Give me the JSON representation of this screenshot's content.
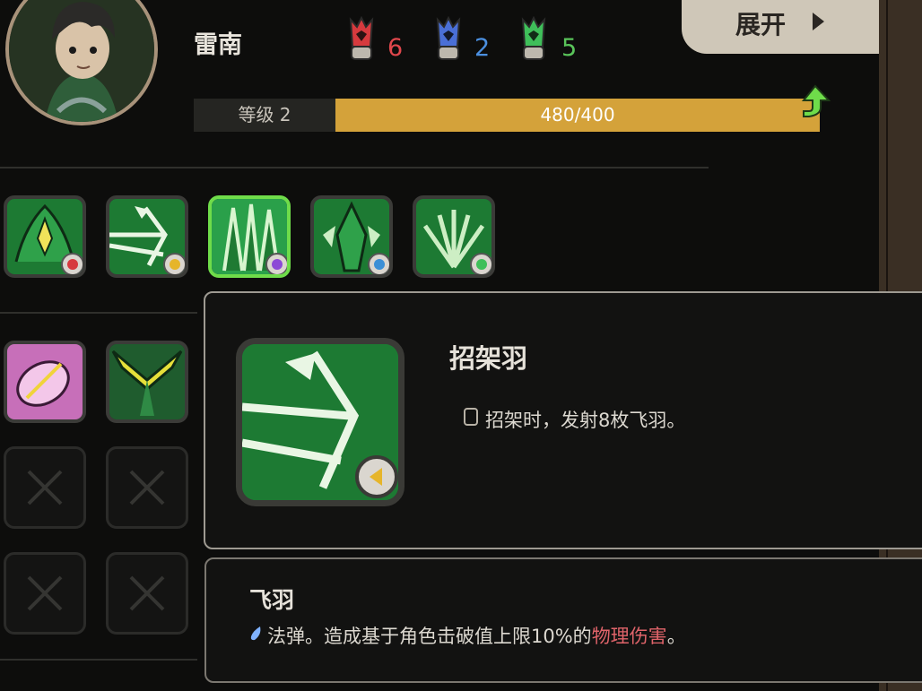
{
  "character": {
    "name": "雷南",
    "level_label": "等级 2",
    "xp_value": "480/400",
    "xp_fraction": 1.0
  },
  "gems": [
    {
      "icon": "red-gem-icon",
      "count": "6",
      "color": "#e0474c"
    },
    {
      "icon": "blue-gem-icon",
      "count": "2",
      "color": "#4b8fe0"
    },
    {
      "icon": "green-gem-icon",
      "count": "5",
      "color": "#59c45a"
    }
  ],
  "expand_button": {
    "label": "展开"
  },
  "skills_row": [
    {
      "name": "skill-1",
      "badge": "red"
    },
    {
      "name": "skill-2",
      "badge": "yellow"
    },
    {
      "name": "skill-3",
      "badge": "purple",
      "selected": true
    },
    {
      "name": "skill-4",
      "badge": "blue"
    },
    {
      "name": "skill-5",
      "badge": "green"
    }
  ],
  "detail": {
    "title": "招架羽",
    "description": "招架时，发射8枚飞羽。"
  },
  "sub_detail": {
    "title": "飞羽",
    "description_prefix": "法弹。造成基于角色击破值上限10%的",
    "description_highlight": "物理伤害",
    "description_suffix": "。"
  },
  "colors": {
    "accent_green": "#6fdc4a",
    "xp_bar": "#d4a23a",
    "highlight_red": "#e0646a"
  }
}
